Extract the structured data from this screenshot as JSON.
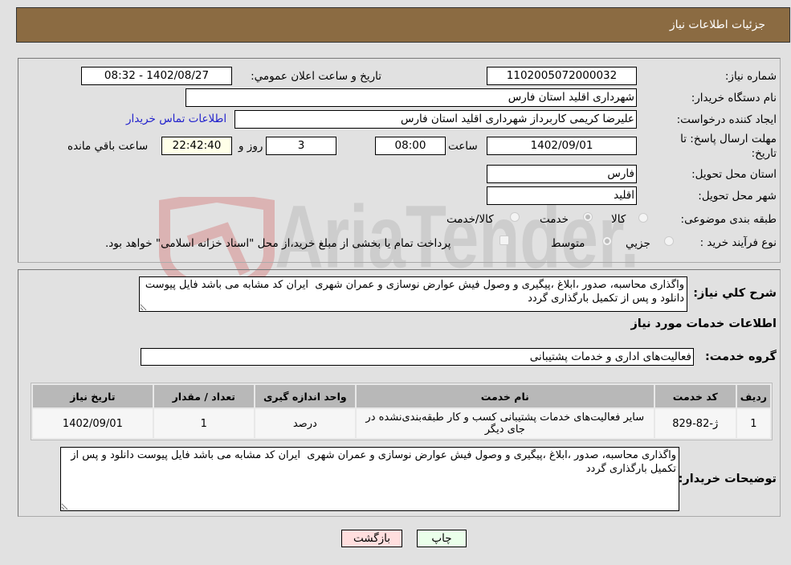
{
  "header": {
    "title": "جزئیات اطلاعات نیاز"
  },
  "details": {
    "need_number_label": "شماره نیاز:",
    "need_number": "1102005072000032",
    "announce_label": "تاریخ و ساعت اعلان عمومي:",
    "announce_value": "1402/08/27 - 08:32",
    "buyer_org_label": "نام دستگاه خريدار:",
    "buyer_org": "شهرداری اقلید استان فارس",
    "creator_label": "ایجاد کننده درخواست:",
    "creator": "علیرضا کریمی  کاربرداز شهرداری اقلید استان فارس",
    "contact_link": "اطلاعات تماس خریدار",
    "deadline_label_1": "مهلت ارسال پاسخ: تا",
    "deadline_label_2": "تاریخ:",
    "deadline_date": "1402/09/01",
    "time_label": "ساعت",
    "deadline_time": "08:00",
    "days_value": "3",
    "days_label": "روز و",
    "remaining_time": "22:42:40",
    "remaining_label": "ساعت باقي مانده",
    "province_label": "استان محل تحویل:",
    "province": "فارس",
    "city_label": "شهر محل تحویل:",
    "city": "اقلید",
    "category_label": "طبقه بندی موضوعی:",
    "category_options": [
      "کالا",
      "خدمت",
      "کالا/خدمت"
    ],
    "category_selected": "خدمت",
    "purchase_type_label": "نوع فرآیند خرید :",
    "purchase_type_options": [
      "جزيي",
      "متوسط"
    ],
    "purchase_type_selected": "متوسط",
    "treasury_note": "پرداخت تمام یا بخشی از مبلغ خرید،از محل \"اسناد خزانه اسلامی\" خواهد بود.",
    "treasury_checked": false
  },
  "description": {
    "label": "شرح كلي نياز:",
    "text": "واگذاری محاسبه، صدور ،ابلاغ ،پیگیری و وصول فیش عوارض نوسازی و عمران شهری  ایران کد مشابه می باشد فایل پیوست دانلود و پس از تکمیل بارگذاری گردد"
  },
  "services": {
    "section_title": "اطلاعات خدمات مورد نیاز",
    "group_label": "گروه خدمت:",
    "group_value": "فعالیت‌های اداری و خدمات پشتیبانی",
    "columns": [
      "رديف",
      "کد خدمت",
      "نام خدمت",
      "واحد اندازه گیری",
      "تعداد / مقدار",
      "تاریخ نیاز"
    ],
    "rows": [
      {
        "index": "1",
        "code": "ژ-82-829",
        "name": "سایر فعالیت‌های خدمات پشتیبانی کسب و کار طبقه‌بندی‌نشده در جای دیگر",
        "unit": "درصد",
        "quantity": "1",
        "date": "1402/09/01"
      }
    ]
  },
  "buyer_notes": {
    "label": "توضیحات خریدار:",
    "text": "واگذاری محاسبه، صدور ،ابلاغ ،پیگیری و وصول فیش عوارض نوسازی و عمران شهری  ایران کد مشابه می باشد فایل پیوست دانلود و پس از تکمیل بارگذاری گردد"
  },
  "buttons": {
    "print": "چاپ",
    "back": "بازگشت",
    "print_color": "#eaffea",
    "back_color": "#ffdede"
  },
  "watermark": {
    "text": "AriaTender.neT"
  }
}
